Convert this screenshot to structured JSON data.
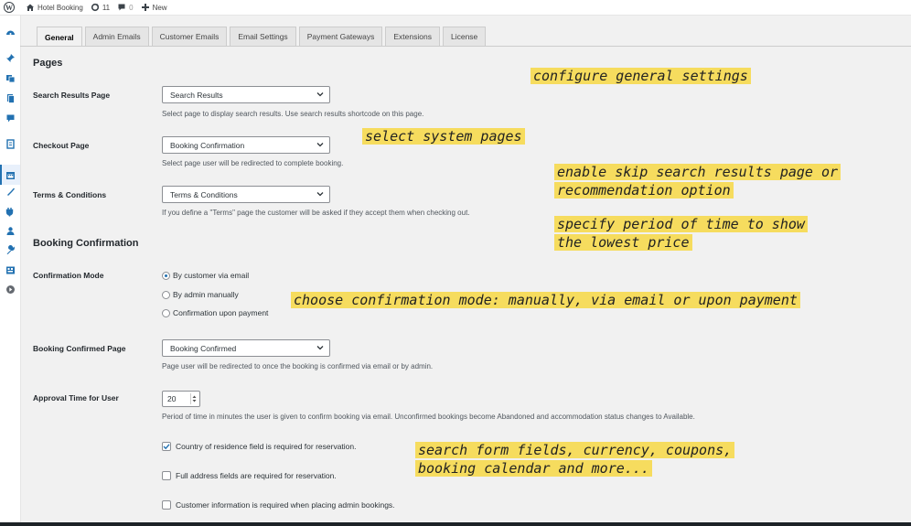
{
  "adminbar": {
    "site_name": "Hotel Booking",
    "updates_count": "11",
    "comments_count": "0",
    "new_label": "New"
  },
  "tabs": [
    "General",
    "Admin Emails",
    "Customer Emails",
    "Email Settings",
    "Payment Gateways",
    "Extensions",
    "License"
  ],
  "pages": {
    "title": "Pages",
    "search_results": {
      "label": "Search Results Page",
      "value": "Search Results",
      "desc": "Select page to display search results. Use search results shortcode on this page."
    },
    "checkout": {
      "label": "Checkout Page",
      "value": "Booking Confirmation",
      "desc": "Select page user will be redirected to complete booking."
    },
    "terms": {
      "label": "Terms & Conditions",
      "value": "Terms & Conditions",
      "desc": "If you define a \"Terms\" page the customer will be asked if they accept them when checking out."
    }
  },
  "booking_confirmation": {
    "title": "Booking Confirmation",
    "mode": {
      "label": "Confirmation Mode",
      "options": [
        "By customer via email",
        "By admin manually",
        "Confirmation upon payment"
      ],
      "selected": "By customer via email"
    },
    "confirmed_page": {
      "label": "Booking Confirmed Page",
      "value": "Booking Confirmed",
      "desc": "Page user will be redirected to once the booking is confirmed via email or by admin."
    },
    "approval_time": {
      "label": "Approval Time for User",
      "value": "20",
      "desc": "Period of time in minutes the user is given to confirm booking via email. Unconfirmed bookings become Abandoned and accommodation status changes to Available."
    }
  },
  "checkboxes": [
    {
      "label": "Country of residence field is required for reservation.",
      "checked": true
    },
    {
      "label": "Full address fields are required for reservation.",
      "checked": false
    },
    {
      "label": "Customer information is required when placing admin bookings.",
      "checked": false
    }
  ],
  "annotations": {
    "general": "configure general settings",
    "system_pages": "select system pages",
    "skip_search_1": "enable skip search results page or",
    "skip_search_2": "recommendation option",
    "period_1": "specify period of time to show",
    "period_2": "the lowest price",
    "confirmation": "choose confirmation mode: manually, via email or upon payment",
    "search_form_1": "search form fields, currency, coupons,",
    "search_form_2": "booking calendar and more..."
  },
  "colors": {
    "accent": "#2271b1",
    "highlight": "#f6dc5e",
    "background": "#f1f1f1"
  }
}
